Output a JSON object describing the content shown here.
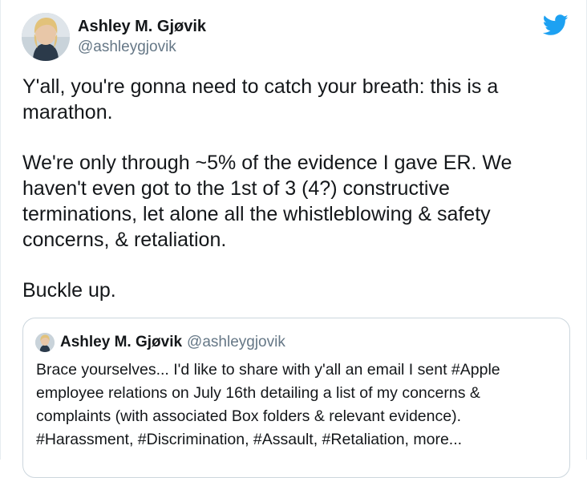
{
  "tweet": {
    "author": {
      "display_name": "Ashley M. Gjøvik",
      "handle": "@ashleygjovik"
    },
    "paragraphs": [
      "Y'all, you're gonna need to catch your breath: this is a\nmarathon.",
      "We're only through ~5% of the evidence I gave ER. We\nhaven't even got to the 1st of 3 (4?) constructive\nterminations, let alone all the whistleblowing & safety\nconcerns, & retaliation.",
      "Buckle up."
    ]
  },
  "quoted_tweet": {
    "author": {
      "display_name": "Ashley M. Gjøvik",
      "handle": "@ashleygjovik"
    },
    "text": "Brace yourselves... I'd like to share with y'all an email I sent #Apple\nemployee relations on July 16th detailing a list of my concerns &\ncomplaints (with associated Box folders & relevant evidence).\n#Harassment, #Discrimination, #Assault, #Retaliation, more..."
  },
  "icons": {
    "brand": "twitter-bird-icon",
    "brand_color": "#1da1f2"
  }
}
